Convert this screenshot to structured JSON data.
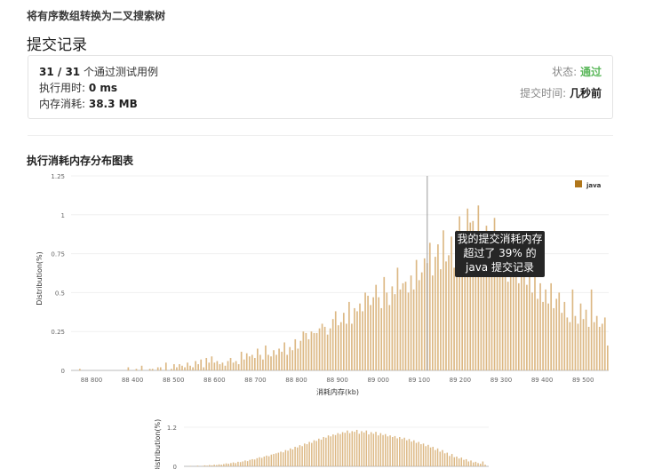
{
  "breadcrumb": "将有序数组转换为二叉搜索树",
  "page_title": "提交记录",
  "summary": {
    "tests_passed": "31 / 31",
    "tests_label": " 个通过测试用例",
    "runtime_label": "执行用时: ",
    "runtime_value": "0 ms",
    "memory_label": "内存消耗: ",
    "memory_value": "38.3 MB",
    "status_label": "状态: ",
    "status_value": "通过",
    "submitted_label": "提交时间: ",
    "submitted_value": "几秒前"
  },
  "chart_section_title": "执行消耗内存分布图表",
  "tooltip": {
    "line1": "我的提交消耗内存",
    "line2": "超过了 39% 的",
    "line3": "java 提交记录"
  },
  "colors": {
    "bar": "#dcb884",
    "accent_bar": "#b0761a",
    "status_ok": "#5cb85c"
  },
  "chart_data": [
    {
      "type": "bar",
      "xlabel": "消耗内存(kb)",
      "ylabel": "Distribution(%)",
      "xlim": [
        88710,
        89510
      ],
      "ylim": [
        0,
        1.25
      ],
      "x_ticks": [
        "88 800",
        "88 400",
        "88 500",
        "88 600",
        "88 700",
        "88 800",
        "88 900",
        "89 000",
        "89 100",
        "89 200",
        "89 300",
        "89 400",
        "89 500"
      ],
      "y_ticks": [
        "0",
        "0.25",
        "0.5",
        "0.75",
        "1",
        "1.25"
      ],
      "legend": [
        "java"
      ],
      "legend_position": "top-right",
      "marker_x": 89240,
      "series": [
        {
          "name": "java",
          "values": [
            0.01,
            0,
            0,
            0,
            0,
            0,
            0,
            0,
            0,
            0,
            0,
            0,
            0,
            0,
            0,
            0,
            0,
            0,
            0.02,
            0,
            0,
            0.01,
            0,
            0.03,
            0,
            0,
            0.01,
            0.01,
            0,
            0.02,
            0.02,
            0,
            0.05,
            0,
            0.01,
            0.04,
            0.02,
            0.04,
            0.03,
            0.02,
            0.05,
            0.03,
            0.02,
            0.06,
            0.04,
            0.07,
            0.02,
            0.08,
            0.05,
            0.09,
            0.05,
            0.06,
            0.04,
            0.05,
            0.03,
            0.06,
            0.08,
            0.05,
            0.06,
            0.04,
            0.12,
            0.07,
            0.11,
            0.09,
            0.1,
            0.08,
            0.14,
            0.1,
            0.07,
            0.16,
            0.1,
            0.09,
            0.13,
            0.1,
            0.14,
            0.12,
            0.18,
            0.1,
            0.15,
            0.13,
            0.2,
            0.14,
            0.19,
            0.25,
            0.24,
            0.2,
            0.25,
            0.24,
            0.24,
            0.27,
            0.3,
            0.28,
            0.23,
            0.27,
            0.33,
            0.38,
            0.29,
            0.31,
            0.37,
            0.3,
            0.44,
            0.3,
            0.4,
            0.38,
            0.43,
            0.38,
            0.5,
            0.48,
            0.42,
            0.47,
            0.55,
            0.47,
            0.4,
            0.6,
            0.5,
            0.42,
            0.54,
            0.49,
            0.66,
            0.52,
            0.56,
            0.57,
            0.5,
            0.61,
            0.52,
            0.71,
            0.58,
            0.63,
            0.72,
            0.69,
            0.82,
            0.61,
            0.73,
            0.81,
            0.65,
            0.9,
            0.7,
            0.74,
            0.86,
            0.66,
            0.9,
            0.99,
            0.88,
            0.8,
            1.04,
            0.95,
            0.96,
            0.88,
            1.06,
            0.77,
            0.74,
            0.93,
            0.6,
            0.67,
            0.98,
            0.7,
            0.77,
            0.82,
            0.76,
            0.57,
            0.85,
            0.6,
            0.71,
            0.56,
            0.75,
            0.68,
            0.55,
            0.73,
            0.5,
            0.65,
            0.46,
            0.56,
            0.44,
            0.52,
            0.43,
            0.56,
            0.4,
            0.46,
            0.5,
            0.37,
            0.44,
            0.34,
            0.31,
            0.52,
            0.35,
            0.3,
            0.43,
            0.33,
            0.39,
            0.28,
            0.52,
            0.31,
            0.35,
            0.28,
            0.3,
            0.34,
            0.16
          ]
        }
      ]
    },
    {
      "type": "bar",
      "ylabel": "Distribution(%)",
      "y_ticks": [
        "1.2",
        "0"
      ],
      "ylim": [
        0,
        1.2
      ],
      "series": [
        {
          "name": "",
          "values": [
            0,
            0.01,
            0,
            0,
            0.02,
            0,
            0.01,
            0.03,
            0.02,
            0.04,
            0.03,
            0.05,
            0.04,
            0.06,
            0.05,
            0.07,
            0.09,
            0.08,
            0.1,
            0.12,
            0.1,
            0.14,
            0.13,
            0.15,
            0.18,
            0.16,
            0.2,
            0.22,
            0.21,
            0.25,
            0.28,
            0.26,
            0.3,
            0.33,
            0.31,
            0.36,
            0.38,
            0.4,
            0.42,
            0.45,
            0.43,
            0.5,
            0.48,
            0.55,
            0.52,
            0.6,
            0.58,
            0.65,
            0.62,
            0.7,
            0.68,
            0.75,
            0.72,
            0.8,
            0.78,
            0.85,
            0.82,
            0.9,
            0.88,
            0.95,
            0.92,
            0.98,
            0.96,
            1.02,
            0.99,
            1.05,
            1.03,
            1.1,
            1.02,
            1.08,
            1.06,
            1.12,
            1.0,
            1.08,
            1.04,
            1.1,
            0.98,
            1.05,
            1.0,
            1.06,
            0.95,
            1.02,
            0.96,
            0.99,
            0.92,
            0.95,
            0.9,
            0.93,
            0.86,
            0.9,
            0.84,
            0.88,
            0.8,
            0.84,
            0.76,
            0.8,
            0.72,
            0.75,
            0.68,
            0.7,
            0.62,
            0.66,
            0.58,
            0.6,
            0.5,
            0.55,
            0.45,
            0.5,
            0.4,
            0.42,
            0.32,
            0.38,
            0.28,
            0.3,
            0.24,
            0.27,
            0.2,
            0.22,
            0.15,
            0.18,
            0.12,
            0.14,
            0.1,
            0.08,
            0.15,
            0.05
          ]
        }
      ]
    }
  ]
}
